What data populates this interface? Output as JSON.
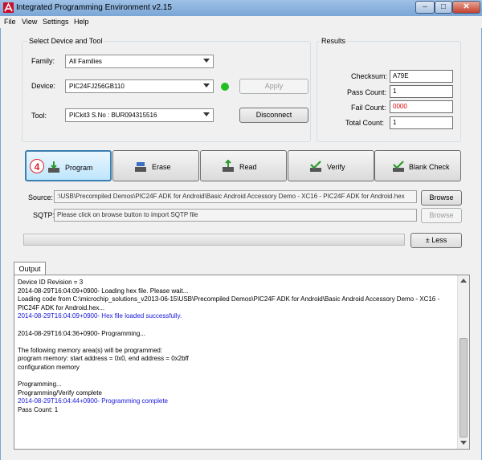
{
  "window": {
    "title": "Integrated Programming Environment v2.15",
    "icon": "ipe-app-icon"
  },
  "menu": [
    "File",
    "View",
    "Settings",
    "Help"
  ],
  "device_group": {
    "title": "Select Device and Tool",
    "family_label": "Family:",
    "family_value": "All Families",
    "device_label": "Device:",
    "device_value": "PIC24FJ256GB110",
    "status_color": "#1fbf22",
    "apply_label": "Apply",
    "tool_label": "Tool:",
    "tool_value": "PICkit3 S.No : BUR094315516",
    "disconnect_label": "Disconnect"
  },
  "results": {
    "title": "Results",
    "checksum_label": "Checksum:",
    "checksum_value": "A79E",
    "pass_label": "Pass Count:",
    "pass_value": "1",
    "fail_label": "Fail Count:",
    "fail_value": "0000",
    "total_label": "Total Count:",
    "total_value": "1"
  },
  "actions": {
    "step_badge": "4",
    "program": "Program",
    "erase": "Erase",
    "read": "Read",
    "verify": "Verify",
    "blank_check": "Blank Check"
  },
  "source": {
    "label": "Source:",
    "value": ":\\USB\\Precompiled Demos\\PIC24F ADK for Android\\Basic Android Accessory Demo - XC16 - PIC24F ADK for Android.hex",
    "browse": "Browse"
  },
  "sqtp": {
    "label": "SQTP:",
    "value": "Please click on browse button to import SQTP file",
    "browse": "Browse"
  },
  "less_button": "± Less",
  "output": {
    "tab": "Output",
    "lines": [
      {
        "text": "Device ID Revision = 3",
        "color": "#000000"
      },
      {
        "text": "2014-08-29T16:04:09+0900- Loading hex file. Please wait...",
        "color": "#000000"
      },
      {
        "text": "Loading code from C:\\microchip_solutions_v2013-06-15\\USB\\Precompiled Demos\\PIC24F ADK for Android\\Basic Android Accessory Demo - XC16 -",
        "color": "#000000"
      },
      {
        "text": "PIC24F ADK for Android.hex...",
        "color": "#000000"
      },
      {
        "text": "2014-08-29T16:04:09+0900- Hex file loaded successfully.",
        "color": "#1717d9"
      },
      {
        "text": "",
        "color": "#000000"
      },
      {
        "text": "2014-08-29T16:04:36+0900- Programming...",
        "color": "#000000"
      },
      {
        "text": "",
        "color": "#000000"
      },
      {
        "text": "The following memory area(s) will be programmed:",
        "color": "#000000"
      },
      {
        "text": "program memory: start address = 0x0, end address = 0x2bff",
        "color": "#000000"
      },
      {
        "text": "configuration memory",
        "color": "#000000"
      },
      {
        "text": "",
        "color": "#000000"
      },
      {
        "text": "Programming...",
        "color": "#000000"
      },
      {
        "text": "Programming/Verify complete",
        "color": "#000000"
      },
      {
        "text": "2014-08-29T16:04:44+0900- Programming complete",
        "color": "#1717d9"
      },
      {
        "text": "Pass Count: 1",
        "color": "#000000"
      }
    ]
  }
}
